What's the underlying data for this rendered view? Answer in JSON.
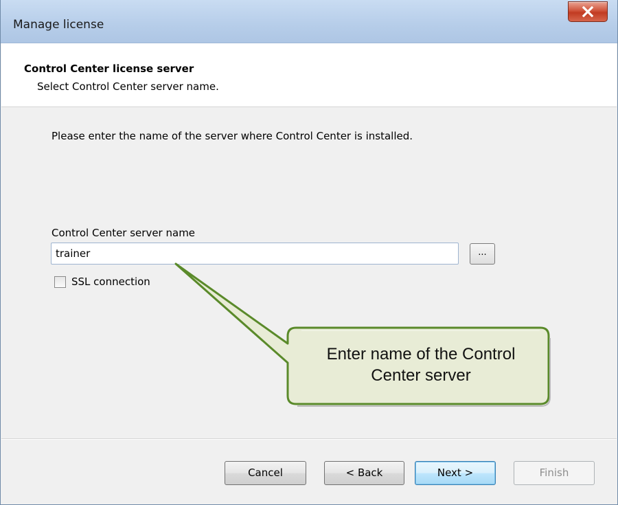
{
  "window": {
    "title": "Manage license",
    "close_label": "X"
  },
  "header": {
    "title": "Control Center license server",
    "subtitle": "Select Control Center server name."
  },
  "content": {
    "instruction": "Please enter the name of the server where Control Center is installed.",
    "server_field": {
      "label": "Control Center server name",
      "value": "trainer"
    },
    "browse_label": "...",
    "ssl": {
      "label": "SSL connection",
      "checked": false
    }
  },
  "callout": {
    "text_line1": "Enter name of the Control",
    "text_line2": "Center server",
    "fill": "#e8ecd6",
    "border": "#5a8a2a"
  },
  "footer": {
    "cancel_label": "Cancel",
    "back_label": "< Back",
    "next_label": "Next >",
    "finish_label": "Finish",
    "finish_enabled": false
  }
}
